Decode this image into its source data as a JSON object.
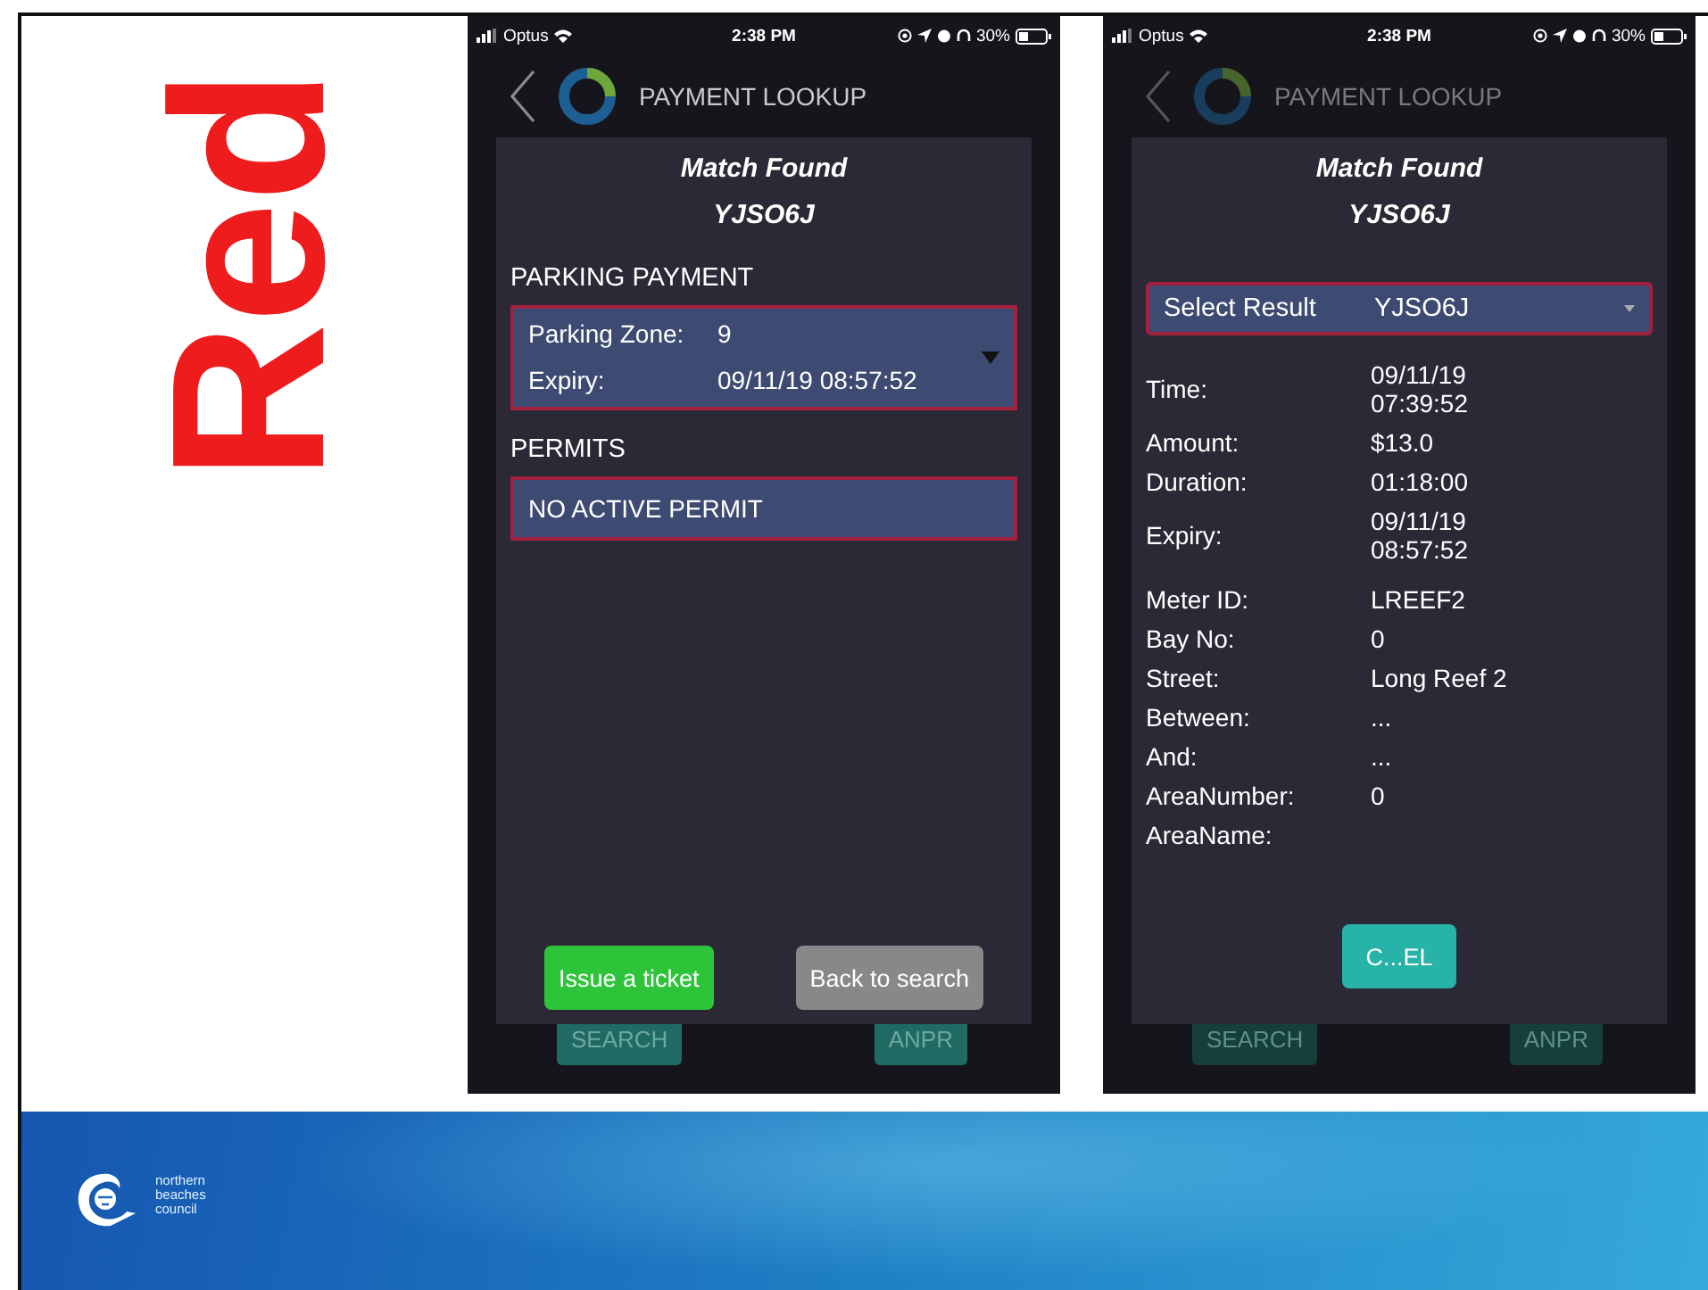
{
  "slide_title": "Red",
  "phones": [
    {
      "status_bar": {
        "carrier": "Optus",
        "time": "2:38 PM",
        "battery": "30%"
      },
      "header": {
        "title": "PAYMENT LOOKUP",
        "dimmed": false
      },
      "card": {
        "title": "Match Found",
        "plate": "YJSO6J",
        "blocks": [
          {
            "kind": "section",
            "label": "PARKING PAYMENT"
          },
          {
            "kind": "info_box",
            "rows": [
              {
                "label": "Parking Zone:",
                "value": "9"
              },
              {
                "label": "Expiry:",
                "value": "09/11/19 08:57:52"
              }
            ]
          },
          {
            "kind": "section",
            "label": "PERMITS"
          },
          {
            "kind": "message_box",
            "text": "NO ACTIVE PERMIT"
          },
          {
            "kind": "actions",
            "buttons": [
              {
                "label": "Issue a ticket",
                "kind": "confirm"
              },
              {
                "label": "Back to search",
                "kind": "neutral"
              }
            ]
          }
        ]
      },
      "bottom_bar": {
        "dimmed": false,
        "buttons": [
          "SEARCH",
          "ANPR"
        ]
      }
    },
    {
      "status_bar": {
        "carrier": "Optus",
        "time": "2:38 PM",
        "battery": "30%"
      },
      "header": {
        "title": "PAYMENT LOOKUP",
        "dimmed": true
      },
      "card": {
        "title": "Match Found",
        "plate": "YJSO6J",
        "blocks": [
          {
            "kind": "select",
            "label": "Select Result",
            "value": "YJSO6J"
          },
          {
            "kind": "details",
            "rows": [
              {
                "label": "Time:",
                "value": "09/11/19 07:39:52"
              },
              {
                "label": "Amount:",
                "value": "$13.0"
              },
              {
                "label": "Duration:",
                "value": "01:18:00"
              },
              {
                "label": "Expiry:",
                "value": "09/11/19 08:57:52"
              },
              {
                "label": "Meter ID:",
                "value": "LREEF2"
              },
              {
                "label": "Bay No:",
                "value": "0"
              },
              {
                "label": "Street:",
                "value": "Long Reef 2"
              },
              {
                "label": "Between:",
                "value": "..."
              },
              {
                "label": "And:",
                "value": "..."
              },
              {
                "label": "AreaNumber:",
                "value": "0"
              },
              {
                "label": "AreaName:"
              }
            ]
          },
          {
            "kind": "actions",
            "buttons": [
              {
                "label": "C...EL",
                "kind": "accent"
              }
            ]
          }
        ]
      },
      "bottom_bar": {
        "dimmed": true,
        "buttons": [
          "SEARCH",
          "ANPR"
        ]
      }
    }
  ],
  "footer": {
    "logo_lines": [
      "northern",
      "beaches",
      "council"
    ]
  }
}
